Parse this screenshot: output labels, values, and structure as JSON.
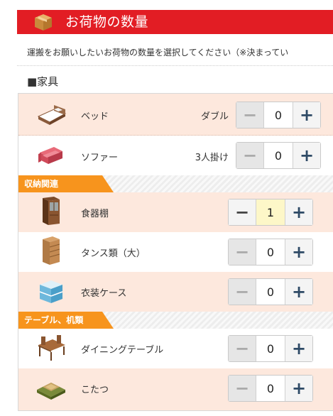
{
  "header": {
    "title": "お荷物の数量"
  },
  "instruction": "運搬をお願いしたいお荷物の数量を選択してください（※決まってい",
  "section": {
    "title": "■家具"
  },
  "rows_top": [
    {
      "name": "ベッド",
      "sub": "ダブル",
      "qty": "0",
      "icon": "bed-icon"
    },
    {
      "name": "ソファー",
      "sub": "3人掛け",
      "qty": "0",
      "icon": "sofa-icon"
    }
  ],
  "categories": [
    {
      "label": "収納関連"
    },
    {
      "label": "テーブル、机類"
    }
  ],
  "rows_storage": [
    {
      "name": "食器棚",
      "qty": "1",
      "icon": "cupboard-icon"
    },
    {
      "name": "タンス類（大）",
      "qty": "0",
      "icon": "chest-of-drawers-icon"
    },
    {
      "name": "衣装ケース",
      "qty": "0",
      "icon": "storage-case-icon"
    }
  ],
  "rows_table": [
    {
      "name": "ダイニングテーブル",
      "qty": "0",
      "icon": "dining-table-icon"
    },
    {
      "name": "こたつ",
      "qty": "0",
      "icon": "kotatsu-icon"
    }
  ],
  "stepper": {
    "minus": "−",
    "plus": "+"
  },
  "colors": {
    "header_red": "#e21d24",
    "category_orange": "#f7941d",
    "row_pink": "#fde8dd",
    "highlight_yellow": "#fdf7c8"
  }
}
